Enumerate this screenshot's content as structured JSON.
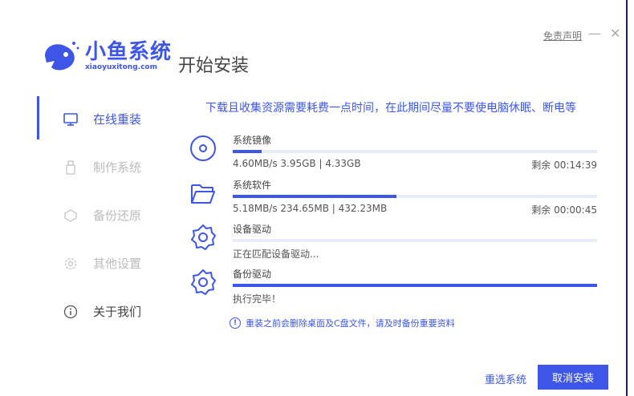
{
  "header": {
    "logo_cn": "小鱼系统",
    "logo_en": "xiaoyuxitong.com",
    "title": "开始安装",
    "disclaimer": "免责声明",
    "minimize": "—",
    "close": "✕"
  },
  "sidebar": {
    "items": [
      {
        "label": "在线重装",
        "icon": "monitor-icon",
        "active": true
      },
      {
        "label": "制作系统",
        "icon": "usb-icon"
      },
      {
        "label": "备份还原",
        "icon": "backup-icon"
      },
      {
        "label": "其他设置",
        "icon": "gear-icon"
      },
      {
        "label": "关于我们",
        "icon": "info-icon"
      }
    ]
  },
  "main": {
    "notice": "下载且收集资源需要耗费一点时间，在此期间尽量不要使电脑休眠、断电等",
    "tasks": [
      {
        "name": "系统镜像",
        "icon": "disc-icon",
        "status": "4.60MB/s 3.95GB | 4.33GB",
        "remaining": "剩余 00:14:39",
        "progress": 0.08
      },
      {
        "name": "系统软件",
        "icon": "folder-icon",
        "status": "5.18MB/s 234.65MB | 432.23MB",
        "remaining": "剩余 00:00:45",
        "progress": 0.45
      },
      {
        "name": "设备驱动",
        "icon": "gear-icon",
        "status": "正在匹配设备驱动...",
        "remaining": "",
        "progress": 0
      },
      {
        "name": "备份驱动",
        "icon": "gear-icon",
        "status": "执行完毕！",
        "remaining": "",
        "progress": 1.0
      }
    ],
    "warning": "重装之前会删除桌面及C盘文件，请及时备份重要资料",
    "warning_icon": "!"
  },
  "footer": {
    "reselect": "重选系统",
    "cancel": "取消安装"
  },
  "colors": {
    "accent": "#3d56e8"
  }
}
